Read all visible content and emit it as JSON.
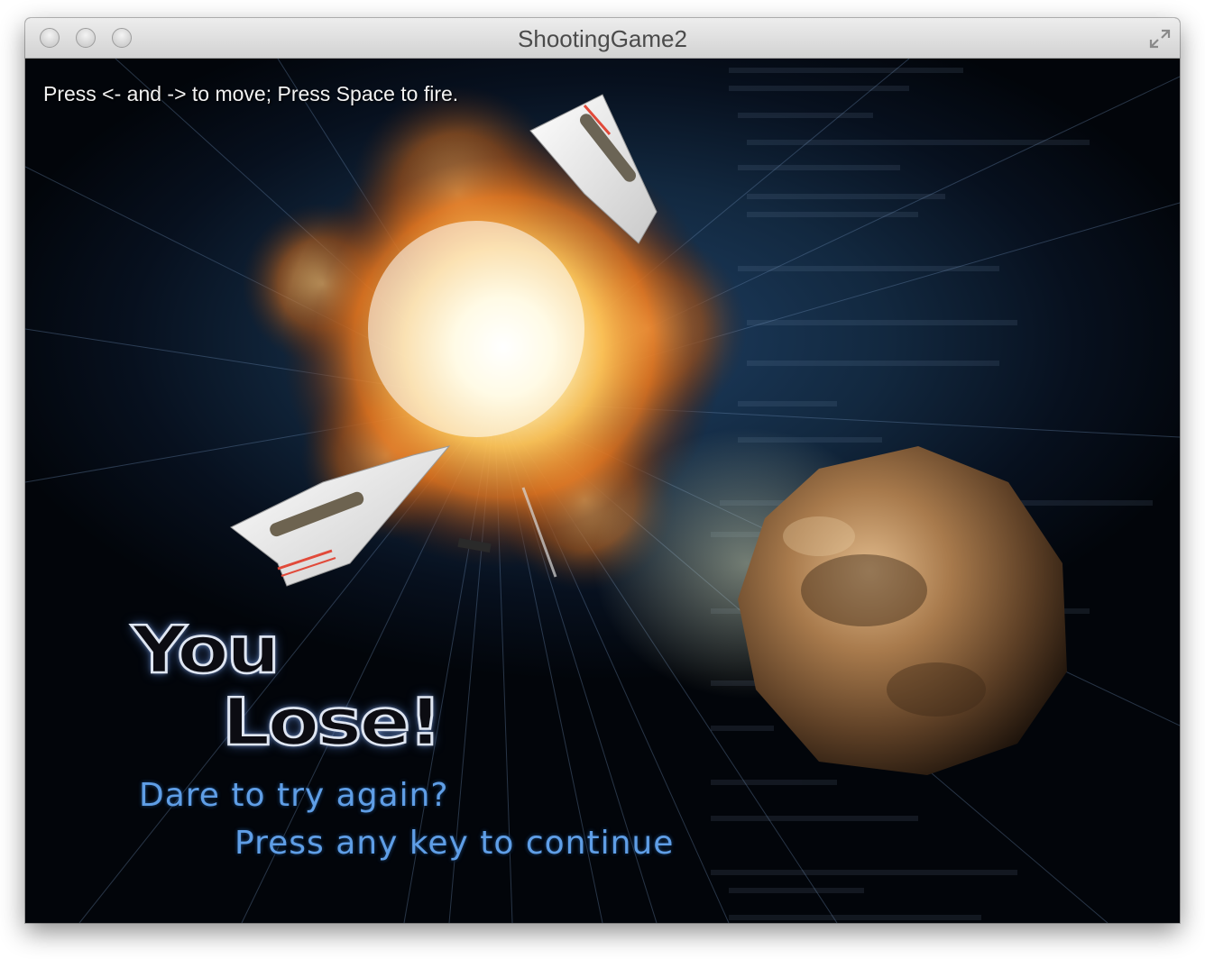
{
  "window": {
    "title": "ShootingGame2"
  },
  "game": {
    "instructions": "Press <- and -> to move; Press Space to fire.",
    "result_line1": "You",
    "result_line2": "Lose!",
    "prompt": "Dare to try again?",
    "continue": "Press any key to continue"
  },
  "colors": {
    "accent_text": "#5f9ee6",
    "background": "#0b1a2e"
  },
  "icons": [
    "close-light",
    "minimize-light",
    "zoom-light",
    "fullscreen-icon"
  ]
}
